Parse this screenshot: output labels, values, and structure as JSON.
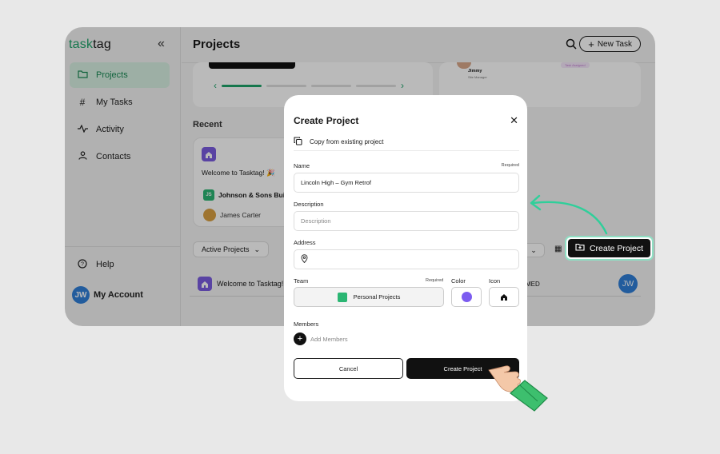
{
  "app": {
    "logo_part1": "task",
    "logo_part2": "tag",
    "page_title": "Projects",
    "new_task_label": "New Task"
  },
  "sidebar": {
    "items": [
      {
        "label": "Projects",
        "icon": "folder-icon"
      },
      {
        "label": "My Tasks",
        "icon": "hash-icon"
      },
      {
        "label": "Activity",
        "icon": "activity-icon"
      },
      {
        "label": "Contacts",
        "icon": "user-icon"
      }
    ],
    "help_label": "Help",
    "account_label": "My Account",
    "account_initials": "JW"
  },
  "background": {
    "card2_name": "Jimmy",
    "card2_role": "Site Manager",
    "card2_tag": "Task Assigned",
    "recent_heading": "Recent",
    "recent_title": "Welcome to Tasktag! 🎉",
    "recent_company": "Johnson & Sons Bui",
    "recent_company_initials": "JS",
    "recent_person": "James Carter",
    "filter_label": "Active Projects",
    "row_project": "Welcome to Tasktag!",
    "row_status": "MED",
    "row_initials": "JW",
    "highlight_button": "Create Project"
  },
  "modal": {
    "title": "Create Project",
    "copy_label": "Copy from existing project",
    "name_label": "Name",
    "name_required": "Required",
    "name_value": "Lincoln High – Gym Retrof",
    "description_label": "Description",
    "description_placeholder": "Description",
    "address_label": "Address",
    "team_label": "Team",
    "team_required": "Required",
    "team_value": "Personal Projects",
    "color_label": "Color",
    "color_value": "#7c5cf0",
    "icon_label": "Icon",
    "members_label": "Members",
    "add_members_label": "Add Members",
    "cancel_label": "Cancel",
    "create_label": "Create Project"
  },
  "colors": {
    "brand": "#1fa36a",
    "accent_highlight": "#8fe0c4",
    "primary_button": "#111111"
  }
}
